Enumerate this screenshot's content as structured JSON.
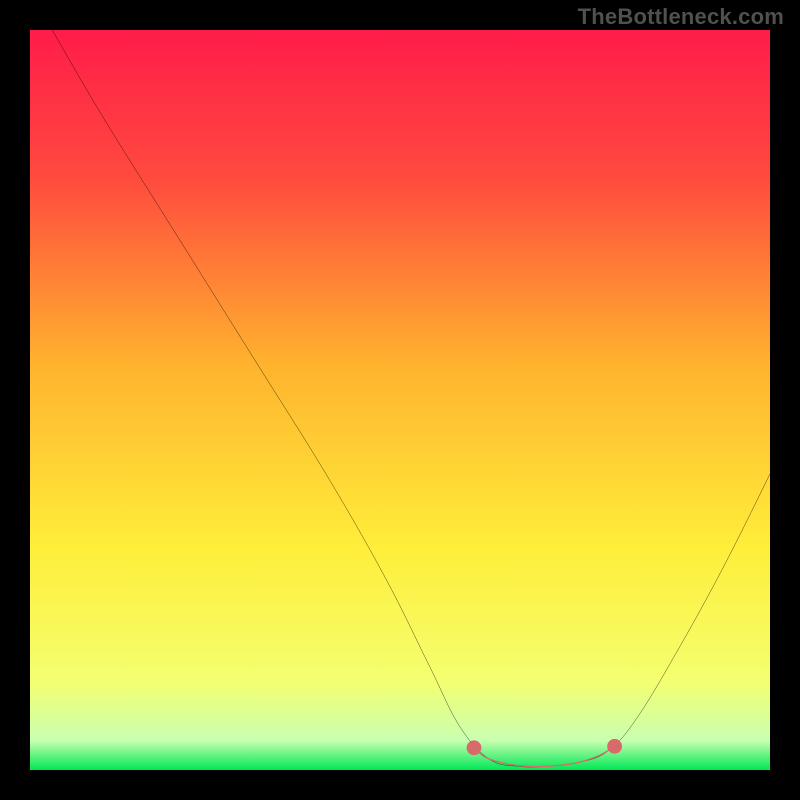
{
  "watermark": "TheBottleneck.com",
  "chart_data": {
    "type": "line",
    "title": "",
    "xlabel": "",
    "ylabel": "",
    "xlim": [
      0,
      100
    ],
    "ylim": [
      0,
      100
    ],
    "gradient_stops": [
      {
        "offset": 0,
        "color": "#ff1c4a"
      },
      {
        "offset": 20,
        "color": "#ff4a3e"
      },
      {
        "offset": 45,
        "color": "#ffb22e"
      },
      {
        "offset": 70,
        "color": "#ffee3a"
      },
      {
        "offset": 88,
        "color": "#f4ff70"
      },
      {
        "offset": 96,
        "color": "#c9ffb0"
      },
      {
        "offset": 100,
        "color": "#00e756"
      }
    ],
    "series": [
      {
        "name": "curve",
        "stroke": "#000000",
        "points": [
          {
            "x": 3,
            "y": 100
          },
          {
            "x": 10,
            "y": 88
          },
          {
            "x": 20,
            "y": 72
          },
          {
            "x": 30,
            "y": 56
          },
          {
            "x": 40,
            "y": 40
          },
          {
            "x": 48,
            "y": 26
          },
          {
            "x": 54,
            "y": 14
          },
          {
            "x": 58,
            "y": 6
          },
          {
            "x": 62,
            "y": 1.5
          },
          {
            "x": 66,
            "y": 0.5
          },
          {
            "x": 70,
            "y": 0.5
          },
          {
            "x": 74,
            "y": 1
          },
          {
            "x": 78,
            "y": 2.5
          },
          {
            "x": 82,
            "y": 7
          },
          {
            "x": 88,
            "y": 17
          },
          {
            "x": 94,
            "y": 28
          },
          {
            "x": 100,
            "y": 40
          }
        ]
      },
      {
        "name": "highlight",
        "stroke": "#d96a6a",
        "points": [
          {
            "x": 60,
            "y": 3
          },
          {
            "x": 62,
            "y": 1.5
          },
          {
            "x": 66,
            "y": 0.6
          },
          {
            "x": 70,
            "y": 0.5
          },
          {
            "x": 74,
            "y": 1
          },
          {
            "x": 77,
            "y": 2
          },
          {
            "x": 79,
            "y": 3.2
          }
        ]
      }
    ],
    "markers": [
      {
        "x": 60,
        "y": 3,
        "r": 1.0,
        "color": "#d96a6a"
      },
      {
        "x": 79,
        "y": 3.2,
        "r": 1.0,
        "color": "#d96a6a"
      }
    ]
  }
}
